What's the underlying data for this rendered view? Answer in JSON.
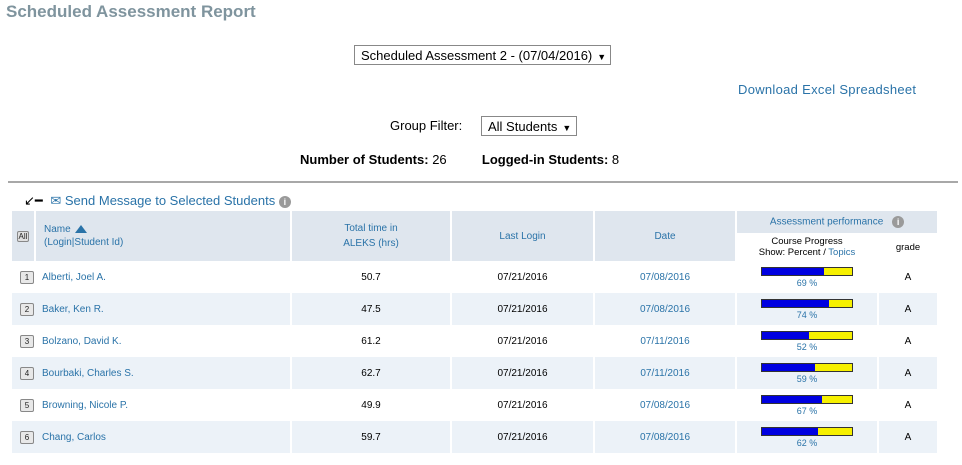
{
  "title": "Scheduled Assessment Report",
  "assessment_select": {
    "value": "Scheduled Assessment 2 - (07/04/2016)"
  },
  "download_link": "Download Excel Spreadsheet",
  "group_filter": {
    "label": "Group Filter:",
    "value": "All Students"
  },
  "counts": {
    "students_label": "Number of Students:",
    "students_value": "26",
    "logged_label": "Logged-in Students:",
    "logged_value": "8"
  },
  "send_message": "Send Message to Selected Students",
  "table": {
    "all_label": "All",
    "headers": {
      "name": "Name",
      "name_sub": "(Login|Student Id)",
      "time_line1": "Total time in",
      "time_line2": "ALEKS (hrs)",
      "last_login": "Last Login",
      "date": "Date",
      "assessment": "Assessment performance",
      "progress_line1": "Course Progress",
      "progress_show": "Show: Percent / ",
      "progress_topics": "Topics",
      "grade": "grade"
    },
    "rows": [
      {
        "num": "1",
        "name": "Alberti, Joel A.",
        "time": "50.7",
        "last_login": "07/21/2016",
        "date": "07/08/2016",
        "progress": 69,
        "progress_label": "69 %",
        "grade": "A"
      },
      {
        "num": "2",
        "name": "Baker, Ken R.",
        "time": "47.5",
        "last_login": "07/21/2016",
        "date": "07/08/2016",
        "progress": 74,
        "progress_label": "74 %",
        "grade": "A"
      },
      {
        "num": "3",
        "name": "Bolzano, David K.",
        "time": "61.2",
        "last_login": "07/21/2016",
        "date": "07/11/2016",
        "progress": 52,
        "progress_label": "52 %",
        "grade": "A"
      },
      {
        "num": "4",
        "name": "Bourbaki, Charles S.",
        "time": "62.7",
        "last_login": "07/21/2016",
        "date": "07/11/2016",
        "progress": 59,
        "progress_label": "59 %",
        "grade": "A"
      },
      {
        "num": "5",
        "name": "Browning, Nicole P.",
        "time": "49.9",
        "last_login": "07/21/2016",
        "date": "07/08/2016",
        "progress": 67,
        "progress_label": "67 %",
        "grade": "A"
      },
      {
        "num": "6",
        "name": "Chang, Carlos",
        "time": "59.7",
        "last_login": "07/21/2016",
        "date": "07/08/2016",
        "progress": 62,
        "progress_label": "62 %",
        "grade": "A"
      }
    ]
  },
  "colors": {
    "link": "#2a73a8",
    "header_bg": "#dfe6ee",
    "bar_fill": "#0000e0",
    "bar_bg": "#f6f000"
  }
}
